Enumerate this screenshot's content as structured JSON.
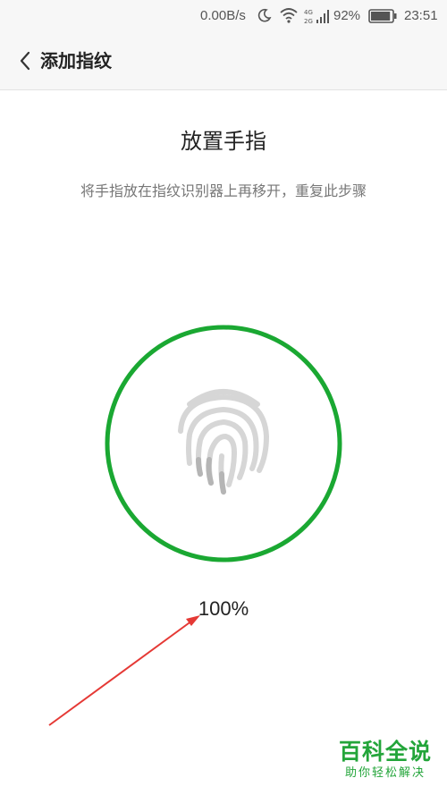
{
  "status_bar": {
    "net_speed": "0.00B/s",
    "network_type_top": "4G",
    "network_type_bottom": "2G",
    "battery_percent": "92%",
    "battery_level": 0.92,
    "time": "23:51",
    "icons": [
      "moon-icon",
      "wifi-icon",
      "signal-icon",
      "battery-icon"
    ]
  },
  "header": {
    "back_icon": "chevron-left-icon",
    "title": "添加指纹"
  },
  "main": {
    "title": "放置手指",
    "instruction": "将手指放在指纹识别器上再移开，重复此步骤",
    "progress": 1.0,
    "progress_label": "100%",
    "ring_color": "#1aa832",
    "fingerprint_icon": "fingerprint-icon"
  },
  "watermark": {
    "brand": "百科全说",
    "slogan": "助你轻松解决",
    "color": "#23a53a"
  },
  "annotation": {
    "arrow_color": "#e53935"
  }
}
